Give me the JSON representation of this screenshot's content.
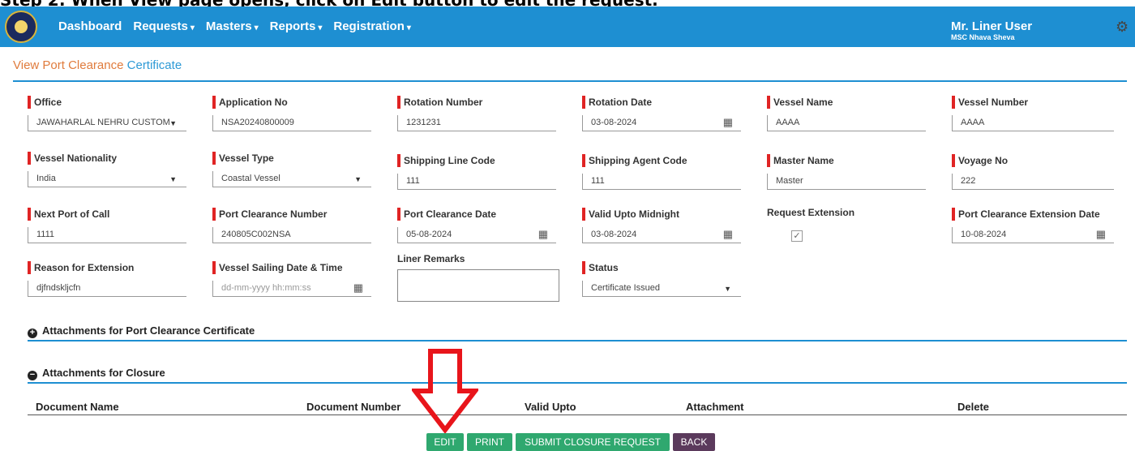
{
  "caption": "Step 2: When View page opens, click on Edit button to edit the request.",
  "navbar": {
    "items": [
      {
        "label": "Dashboard",
        "caret": ""
      },
      {
        "label": "Requests",
        "caret": "▾"
      },
      {
        "label": "Masters",
        "caret": "▾"
      },
      {
        "label": "Reports",
        "caret": "▾"
      },
      {
        "label": "Registration",
        "caret": "▾"
      }
    ],
    "user_name": "Mr. Liner User",
    "user_sub": "MSC Nhava Sheva"
  },
  "page": {
    "title_part1": "View Port Clearance",
    "title_part2": "Certificate"
  },
  "fields": [
    {
      "label": "Office",
      "value": "JAWAHARLAL NEHRU CUSTOM",
      "kind": "select"
    },
    {
      "label": "Application No",
      "value": "NSA20240800009",
      "kind": "text"
    },
    {
      "label": "Rotation Number",
      "value": "1231231",
      "kind": "text"
    },
    {
      "label": "Rotation Date",
      "value": "03-08-2024",
      "kind": "date"
    },
    {
      "label": "Vessel Name",
      "value": "AAAA",
      "kind": "text"
    },
    {
      "label": "Vessel Number",
      "value": "AAAA",
      "kind": "text"
    },
    {
      "label": "Vessel Nationality",
      "value": "India",
      "kind": "select"
    },
    {
      "label": "Vessel Type",
      "value": "Coastal Vessel",
      "kind": "select"
    },
    {
      "label": "Shipping Line Code",
      "value": "111",
      "kind": "text"
    },
    {
      "label": "Shipping Agent Code",
      "value": "111",
      "kind": "text"
    },
    {
      "label": "Master Name",
      "value": "Master",
      "kind": "text"
    },
    {
      "label": "Voyage No",
      "value": "222",
      "kind": "text"
    },
    {
      "label": "Next Port of Call",
      "value": "1111",
      "kind": "text"
    },
    {
      "label": "Port Clearance Number",
      "value": "240805C002NSA",
      "kind": "text"
    },
    {
      "label": "Port Clearance Date",
      "value": "05-08-2024",
      "kind": "date"
    },
    {
      "label": "Valid Upto Midnight",
      "value": "03-08-2024",
      "kind": "date"
    },
    {
      "label": "Request Extension",
      "checked": "✓",
      "kind": "checkbox"
    },
    {
      "label": "Port Clearance Extension Date",
      "value": "10-08-2024",
      "kind": "date"
    },
    {
      "label": "Reason for Extension",
      "value": "djfndskljcfn",
      "kind": "text"
    },
    {
      "label": "Vessel Sailing Date & Time",
      "placeholder": "dd-mm-yyyy hh:mm:ss",
      "kind": "date"
    },
    {
      "label": "Liner Remarks",
      "value": "",
      "kind": "textarea"
    },
    {
      "label": "Status",
      "value": "Certificate Issued",
      "kind": "select"
    }
  ],
  "icons": {
    "calendar": "calendar-icon",
    "dropdown": "caret-down-icon",
    "settings": "gear-icon"
  },
  "sections": {
    "attachments_pcc": {
      "label": "Attachments for Port Clearance Certificate",
      "icon": "+"
    },
    "attachments_closure": {
      "label": "Attachments for Closure",
      "icon": "−"
    }
  },
  "table": {
    "headers": [
      "Document Name",
      "Document Number",
      "Valid Upto",
      "Attachment",
      "Delete"
    ]
  },
  "buttons": {
    "edit": "EDIT",
    "print": "PRINT",
    "submit": "SUBMIT CLOSURE REQUEST",
    "back": "BACK"
  },
  "colors": {
    "navbar": "#1e8fd2",
    "required": "#e02424",
    "button_green": "#2fa86f",
    "button_back": "#5b3a5c",
    "arrow": "#e8151b"
  }
}
